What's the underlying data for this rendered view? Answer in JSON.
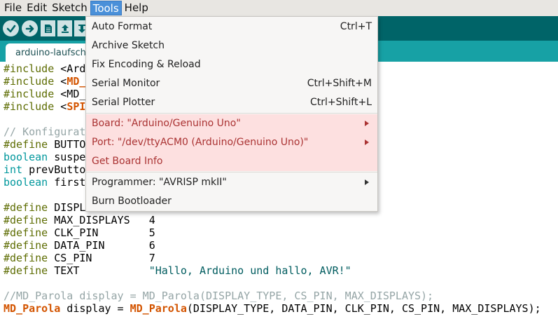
{
  "menubar": {
    "items": [
      "File",
      "Edit",
      "Sketch",
      "Tools",
      "Help"
    ]
  },
  "toolbar": {
    "buttons": [
      "verify-icon",
      "upload-icon",
      "new-icon",
      "open-icon",
      "save-icon"
    ]
  },
  "tab": {
    "label": "arduino-laufschrift"
  },
  "tools_menu": {
    "auto_format": {
      "label": "Auto Format",
      "shortcut": "Ctrl+T"
    },
    "archive_sketch": {
      "label": "Archive Sketch"
    },
    "fix_encoding": {
      "label": "Fix Encoding & Reload"
    },
    "serial_monitor": {
      "label": "Serial Monitor",
      "shortcut": "Ctrl+Shift+M"
    },
    "serial_plotter": {
      "label": "Serial Plotter",
      "shortcut": "Ctrl+Shift+L"
    },
    "board": {
      "label": "Board: \"Arduino/Genuino Uno\""
    },
    "port": {
      "label": "Port: \"/dev/ttyACM0 (Arduino/Genuino Uno)\""
    },
    "get_board_info": {
      "label": "Get Board Info"
    },
    "programmer": {
      "label": "Programmer: \"AVRISP mkII\""
    },
    "burn_bootloader": {
      "label": "Burn Bootloader"
    }
  },
  "code": {
    "l1": {
      "a": "#include",
      "b": " <Ard"
    },
    "l2": {
      "a": "#include",
      "b": " <",
      "c": "MD_"
    },
    "l3": {
      "a": "#include",
      "b": " <MD_"
    },
    "l4": {
      "a": "#include",
      "b": " <",
      "c": "SPI"
    },
    "l6": {
      "a": "// Konfigurat"
    },
    "l7": {
      "a": "#define",
      "b": " BUTTO"
    },
    "l8": {
      "a": "boolean",
      "b": " suspe"
    },
    "l9": {
      "a": "int",
      "b": " prevButto"
    },
    "l10": {
      "a": "boolean",
      "b": " first"
    },
    "l12": {
      "a": "#define",
      "b": " DISPL"
    },
    "l13": {
      "a": "#define",
      "b": " MAX_DISPLAYS   4"
    },
    "l14": {
      "a": "#define",
      "b": " CLK_PIN        5"
    },
    "l15": {
      "a": "#define",
      "b": " DATA_PIN       6"
    },
    "l16": {
      "a": "#define",
      "b": " CS_PIN         7"
    },
    "l17": {
      "a": "#define",
      "b": " TEXT           ",
      "c": "\"Hallo, Arduino und hallo, AVR!\""
    },
    "l19": {
      "a": "//MD_Parola display = MD_Parola(DISPLAY_TYPE, CS_PIN, MAX_DISPLAYS);"
    },
    "l20": {
      "a": "MD_Parola",
      "b": " display = ",
      "c": "MD_Parola",
      "d": "(DISPLAY_TYPE, DATA_PIN, CLK_PIN, CS_PIN, MAX_DISPLAYS);"
    }
  },
  "colors": {
    "toolbar": "#006468",
    "tabbar": "#17a1a5",
    "highlight": "#fde0e0",
    "directive": "#5e6d03",
    "type": "#00979c",
    "library": "#d35400"
  }
}
